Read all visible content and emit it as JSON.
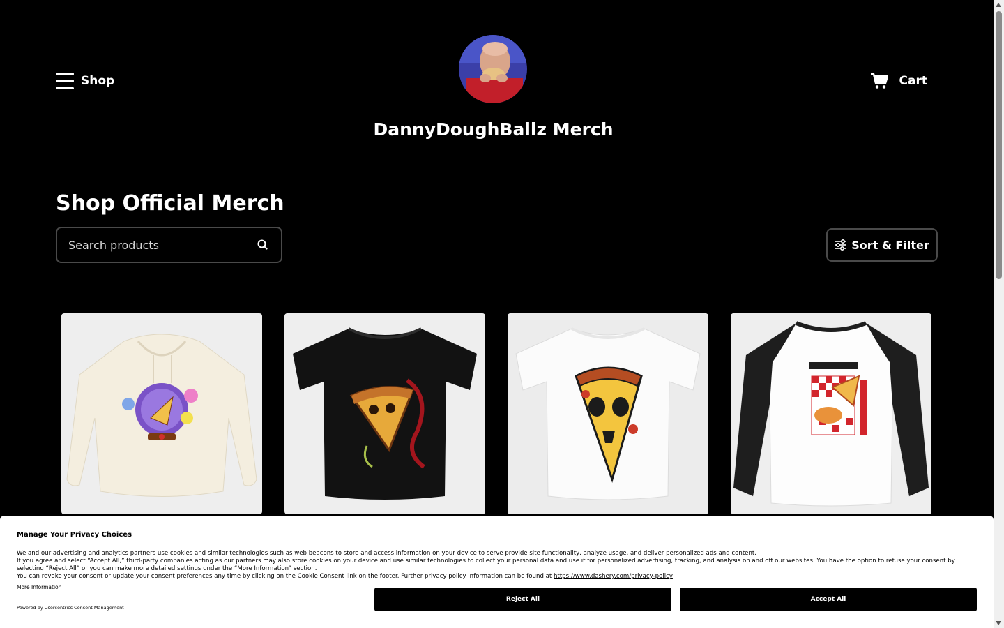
{
  "header": {
    "shop_label": "Shop",
    "cart_label": "Cart",
    "store_title": "DannyDoughBallz Merch"
  },
  "main": {
    "title": "Shop Official Merch",
    "search_placeholder": "Search products",
    "sort_filter_label": "Sort & Filter"
  },
  "consent": {
    "title": "Manage Your Privacy Choices",
    "line1": "We and our advertising and analytics partners use cookies and similar technologies such as web beacons to store and access information on your device to serve provide site functionality, analyze usage, and deliver personalized ads and content.",
    "line2": "If you agree and select “Accept All,” third-party companies acting as our partners may also store cookies on your device and use similar technologies to collect your personal data and use it for personalized advertising, tracking, and analysis on and off our websites. You have the option to refuse your consent by selecting “Reject All” or you can make more detailed settings under the “More Information” section.",
    "line3": "You can revoke your consent or update your consent preferences any time by clicking on the Cookie Consent link on the footer. Further privacy policy information can be found at",
    "policy_link": "https://www.dashery.com/privacy-policy",
    "more_info": "More Information",
    "powered_by": "Powered by Usercentrics Consent Management",
    "reject_label": "Reject All",
    "accept_label": "Accept All"
  },
  "products": [
    "hoodie",
    "black-tee",
    "white-tee",
    "raglan-tee"
  ],
  "colors": {
    "background": "#000000",
    "text": "#ffffff",
    "consent_bg": "#ffffff",
    "button_bg": "#000000"
  }
}
